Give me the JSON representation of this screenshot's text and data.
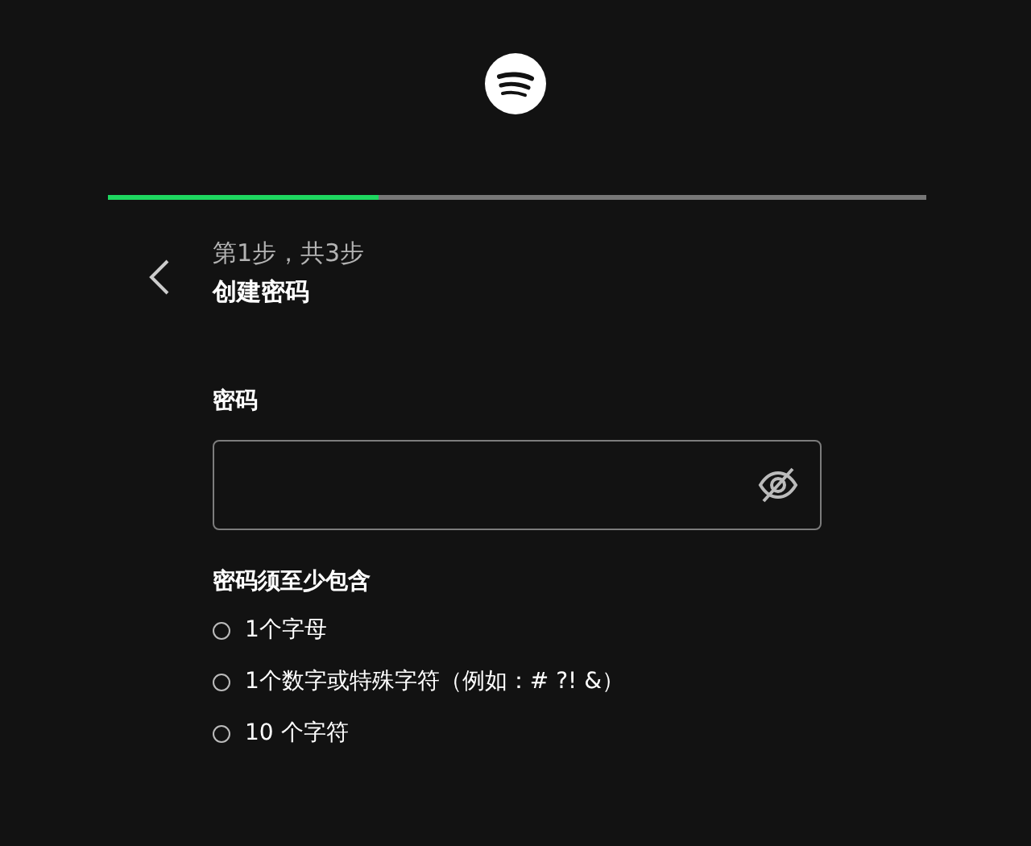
{
  "progress": {
    "level": 0.33
  },
  "step": "第1步，共3步",
  "title": "创建密码",
  "password": {
    "label": "密码",
    "visible": false
  },
  "requirements": {
    "title": "密码须至少包含",
    "items": [
      {
        "text": "1个字母",
        "met": false
      },
      {
        "text": "1个数字或特殊字符（例如：# ?! &）",
        "met": false
      },
      {
        "text": "10 个字符",
        "met": false
      }
    ]
  }
}
